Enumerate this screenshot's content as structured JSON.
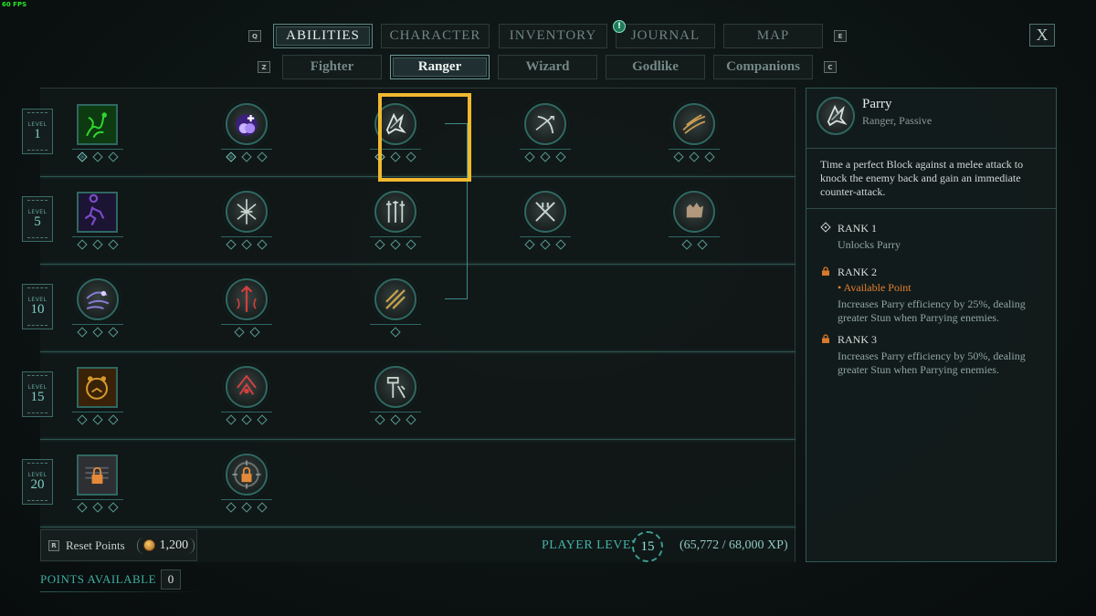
{
  "fps": "60 FPS",
  "main_tabs": {
    "left_key": "Q",
    "right_key": "E",
    "items": [
      {
        "label": "ABILITIES",
        "active": true
      },
      {
        "label": "CHARACTER",
        "active": false
      },
      {
        "label": "INVENTORY",
        "active": false
      },
      {
        "label": "JOURNAL",
        "active": false,
        "alert": "!"
      },
      {
        "label": "MAP",
        "active": false
      }
    ]
  },
  "sub_tabs": {
    "left_key": "Z",
    "right_key": "C",
    "items": [
      {
        "label": "Fighter",
        "active": false
      },
      {
        "label": "Ranger",
        "active": true
      },
      {
        "label": "Wizard",
        "active": false
      },
      {
        "label": "Godlike",
        "active": false
      },
      {
        "label": "Companions",
        "active": false
      }
    ]
  },
  "close_label": "X",
  "level_word": "LEVEL",
  "tiers": [
    {
      "level": "1",
      "abilities": [
        {
          "icon": "vine-snare-icon",
          "shape": "square",
          "ranks": 3,
          "filled": 1,
          "accent": "#2fd62f"
        },
        {
          "icon": "heal-orb-icon",
          "shape": "circle",
          "ranks": 3,
          "filled": 1,
          "accent": "#8d5bff"
        },
        {
          "icon": "parry-icon",
          "shape": "circle",
          "ranks": 3,
          "filled": 1,
          "accent": "#c9d4d0",
          "selected": true
        },
        {
          "icon": "bow-shot-icon",
          "shape": "circle",
          "ranks": 3,
          "filled": 0,
          "accent": "#c9d4d0"
        },
        {
          "icon": "quick-strike-icon",
          "shape": "circle",
          "ranks": 3,
          "filled": 0,
          "accent": "#c89a52"
        }
      ]
    },
    {
      "level": "5",
      "abilities": [
        {
          "icon": "shadow-dash-icon",
          "shape": "square",
          "ranks": 3,
          "filled": 0,
          "accent": "#7b4bc9"
        },
        {
          "icon": "blade-flurry-icon",
          "shape": "circle",
          "ranks": 3,
          "filled": 0,
          "accent": "#c9d4d0"
        },
        {
          "icon": "weapon-rack-icon",
          "shape": "circle",
          "ranks": 3,
          "filled": 0,
          "accent": "#c9d4d0"
        },
        {
          "icon": "crossed-blades-icon",
          "shape": "circle",
          "ranks": 3,
          "filled": 0,
          "accent": "#c9d4d0"
        },
        {
          "icon": "grab-hand-icon",
          "shape": "circle",
          "ranks": 2,
          "filled": 0,
          "accent": "#c9a98a"
        }
      ]
    },
    {
      "level": "10",
      "abilities": [
        {
          "icon": "wind-dash-icon",
          "shape": "circle",
          "ranks": 3,
          "filled": 0,
          "accent": "#8a7ad6"
        },
        {
          "icon": "blood-spear-icon",
          "shape": "circle",
          "ranks": 2,
          "filled": 0,
          "accent": "#d23f3f"
        },
        {
          "icon": "riposte-icon",
          "shape": "circle",
          "ranks": 1,
          "filled": 0,
          "accent": "#c9a24a"
        }
      ]
    },
    {
      "level": "15",
      "abilities": [
        {
          "icon": "bear-roar-icon",
          "shape": "square",
          "ranks": 3,
          "filled": 0,
          "accent": "#d59a2c"
        },
        {
          "icon": "war-cry-icon",
          "shape": "circle",
          "ranks": 3,
          "filled": 0,
          "accent": "#d23f3f"
        },
        {
          "icon": "hammer-smash-icon",
          "shape": "circle",
          "ranks": 3,
          "filled": 0,
          "accent": "#c9d4d0"
        }
      ]
    },
    {
      "level": "20",
      "abilities": [
        {
          "icon": "locked-shield-icon",
          "shape": "square",
          "ranks": 3,
          "filled": 0,
          "accent": "#e58a3a",
          "locked": true
        },
        {
          "icon": "locked-sigil-icon",
          "shape": "circle",
          "ranks": 3,
          "filled": 0,
          "accent": "#e58a3a",
          "locked": true
        }
      ]
    }
  ],
  "footer": {
    "reset_key": "R",
    "reset_label": "Reset Points",
    "reset_cost": "1,200",
    "player_level_label": "PLAYER LEVEL",
    "player_level": "15",
    "xp": "(65,772 / 68,000 XP)",
    "points_label": "POINTS AVAILABLE",
    "points_value": "0"
  },
  "details": {
    "name": "Parry",
    "subtitle": "Ranger, Passive",
    "description": "Time a perfect Block against a melee attack to knock the enemy back and gain an immediate counter-attack.",
    "ranks": [
      {
        "title": "RANK 1",
        "available": "",
        "text": "Unlocks Parry",
        "locked": false
      },
      {
        "title": "RANK 2",
        "available": "• Available Point",
        "text": "Increases Parry efficiency by 25%, dealing greater Stun when Parrying enemies.",
        "locked": true
      },
      {
        "title": "RANK 3",
        "available": "",
        "text": "Increases Parry efficiency by 50%, dealing greater Stun when Parrying enemies.",
        "locked": true
      }
    ]
  },
  "colors": {
    "accent_teal": "#3faea3",
    "highlight": "#f0b82e",
    "available_orange": "#e2802f"
  }
}
